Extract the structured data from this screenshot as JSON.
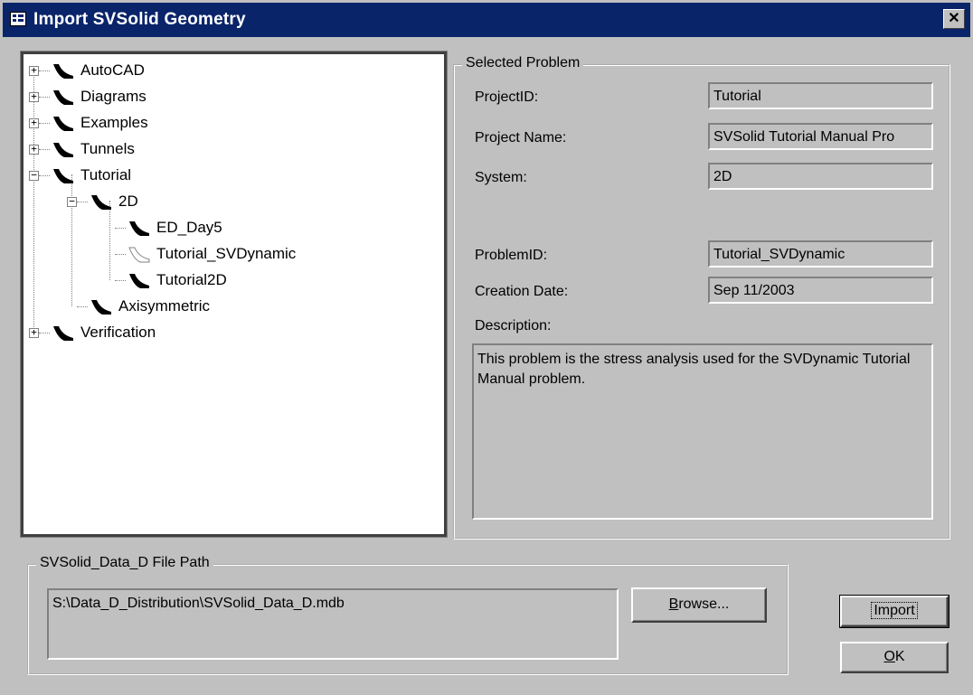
{
  "window": {
    "title": "Import SVSolid Geometry",
    "close_label": "✕"
  },
  "tree": {
    "nodes": [
      {
        "label": "AutoCAD",
        "expander": "+"
      },
      {
        "label": "Diagrams",
        "expander": "+"
      },
      {
        "label": "Examples",
        "expander": "+"
      },
      {
        "label": "Tunnels",
        "expander": "+"
      },
      {
        "label": "Tutorial",
        "expander": "−"
      },
      {
        "label": "2D",
        "expander": "−"
      },
      {
        "label": "ED_Day5"
      },
      {
        "label": "Tutorial_SVDynamic",
        "selected_faded": true
      },
      {
        "label": "Tutorial2D"
      },
      {
        "label": "Axisymmetric"
      },
      {
        "label": "Verification",
        "expander": "+"
      }
    ]
  },
  "selected_problem": {
    "legend": "Selected Problem",
    "project_id_label": "ProjectID:",
    "project_id_value": "Tutorial",
    "project_name_label": "Project Name:",
    "project_name_value": "SVSolid Tutorial Manual Pro",
    "system_label": "System:",
    "system_value": "2D",
    "problem_id_label": "ProblemID:",
    "problem_id_value": "Tutorial_SVDynamic",
    "creation_date_label": "Creation Date:",
    "creation_date_value": "Sep 11/2003",
    "description_label": "Description:",
    "description_value": "This problem is the stress analysis used for the SVDynamic Tutorial Manual problem."
  },
  "file_path": {
    "legend": "SVSolid_Data_D File Path",
    "value": "S:\\Data_D_Distribution\\SVSolid_Data_D.mdb",
    "browse_label_pre": "",
    "browse_label_u": "B",
    "browse_label_post": "rowse..."
  },
  "buttons": {
    "import_label": "Import",
    "ok_label_u": "O",
    "ok_label_post": "K"
  }
}
